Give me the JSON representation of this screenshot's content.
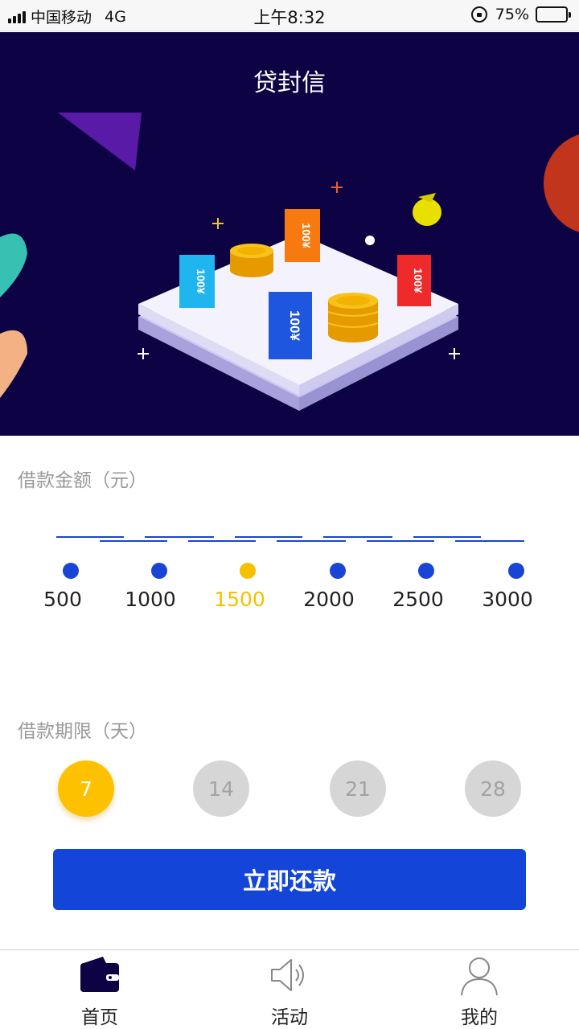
{
  "status_bar": {
    "carrier": "中国移动",
    "network": "4G",
    "time": "上午8:32",
    "battery": "75%",
    "battery_level": 0.75
  },
  "header": {
    "title": "贷封信"
  },
  "hero": {
    "tickets": [
      "100¥",
      "100¥",
      "100¥",
      "100¥"
    ],
    "colors": {
      "background": "#0d0344",
      "ticket_blue": "#1e56e0",
      "ticket_cyan": "#21b5f0",
      "ticket_orange": "#f77a10",
      "ticket_red": "#ee2a2a",
      "coin": "#f0a800"
    }
  },
  "amount": {
    "label": "借款金额（元）",
    "options": [
      "500",
      "1000",
      "1500",
      "2000",
      "2500",
      "3000"
    ],
    "selected_index": 2
  },
  "term": {
    "label": "借款期限（天）",
    "options": [
      "7",
      "14",
      "21",
      "28"
    ],
    "selected_index": 0
  },
  "cta": {
    "label": "立即还款"
  },
  "tabbar": {
    "items": [
      {
        "label": "首页",
        "icon": "wallet-icon"
      },
      {
        "label": "活动",
        "icon": "speaker-icon"
      },
      {
        "label": "我的",
        "icon": "user-icon"
      }
    ]
  },
  "colors": {
    "accent": "#1245d8",
    "selected": "#fec100",
    "unselected": "#d6d6d6"
  }
}
